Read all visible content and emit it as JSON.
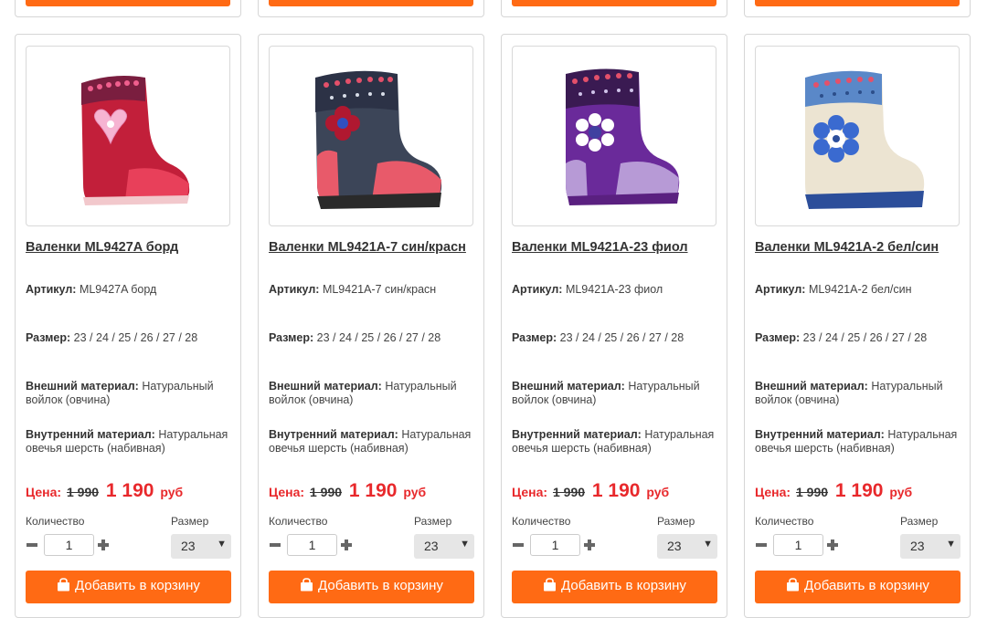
{
  "labels": {
    "article": "Артикул:",
    "size": "Размер:",
    "outer_material": "Внешний материал:",
    "inner_material": "Внутренний материал:",
    "price": "Цена:",
    "currency": "руб",
    "quantity": "Количество",
    "size_select": "Размер",
    "add_to_cart": "Добавить в корзину"
  },
  "colors": {
    "accent": "#ff6a14",
    "price_red": "#e8282b"
  },
  "products": [
    {
      "title": "Валенки ML9427A борд",
      "article": "ML9427A борд",
      "sizes": "23 / 24 / 25 / 26 / 27 / 28",
      "outer_material": "Натуральный войлок (овчина)",
      "inner_material": "Натуральная овечья шерсть (набивная)",
      "old_price": "1 990",
      "new_price": "1 190",
      "quantity": "1",
      "selected_size": "23",
      "image_icon": "felt-boot-burgundy-heart"
    },
    {
      "title": "Валенки ML9421A-7 син/красн",
      "article": "ML9421A-7 син/красн",
      "sizes": "23 / 24 / 25 / 26 / 27 / 28",
      "outer_material": "Натуральный войлок (овчина)",
      "inner_material": "Натуральная овечья шерсть (набивная)",
      "old_price": "1 990",
      "new_price": "1 190",
      "quantity": "1",
      "selected_size": "23",
      "image_icon": "felt-boot-grey-red-flower"
    },
    {
      "title": "Валенки ML9421A-23 фиол",
      "article": "ML9421A-23 фиол",
      "sizes": "23 / 24 / 25 / 26 / 27 / 28",
      "outer_material": "Натуральный войлок (овчина)",
      "inner_material": "Натуральная овечья шерсть (набивная)",
      "old_price": "1 990",
      "new_price": "1 190",
      "quantity": "1",
      "selected_size": "23",
      "image_icon": "felt-boot-purple-flower"
    },
    {
      "title": "Валенки ML9421A-2 бел/син",
      "article": "ML9421A-2 бел/син",
      "sizes": "23 / 24 / 25 / 26 / 27 / 28",
      "outer_material": "Натуральный войлок (овчина)",
      "inner_material": "Натуральная овечья шерсть (набивная)",
      "old_price": "1 990",
      "new_price": "1 190",
      "quantity": "1",
      "selected_size": "23",
      "image_icon": "felt-boot-white-blue-flower"
    }
  ]
}
